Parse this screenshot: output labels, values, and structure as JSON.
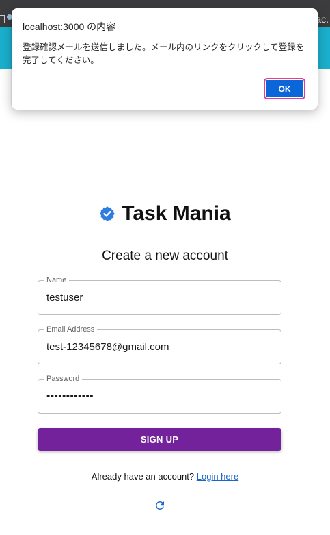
{
  "browser": {
    "right_text": "ac."
  },
  "dialog": {
    "title": "localhost:3000 の内容",
    "message": "登録確認メールを送信しました。メール内のリンクをクリックして登録を完了してください。",
    "ok_label": "OK"
  },
  "brand": {
    "name": "Task Mania",
    "icon": "verified-badge-icon"
  },
  "form": {
    "heading": "Create a new account",
    "name": {
      "label": "Name",
      "value": "testuser"
    },
    "email": {
      "label": "Email Address",
      "value": "test-12345678@gmail.com"
    },
    "password": {
      "label": "Password",
      "value": "••••••••••••"
    },
    "submit_label": "SIGN UP",
    "login_prompt": "Already have an account?",
    "login_link": "Login here"
  },
  "colors": {
    "app_bar": "#1ab0cd",
    "primary_button": "#74229c",
    "dialog_button": "#0b67d9",
    "link": "#1a66c9",
    "badge": "#2f7de1"
  }
}
